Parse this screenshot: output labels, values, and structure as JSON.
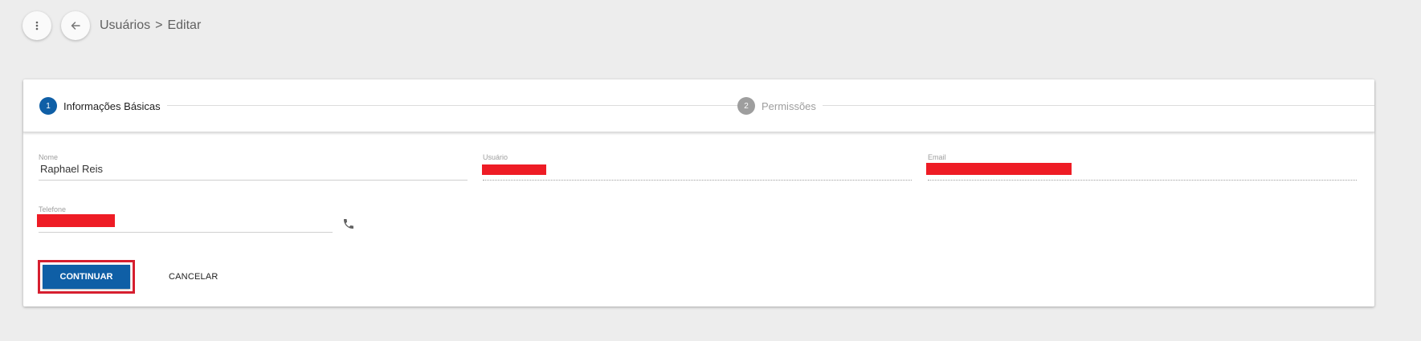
{
  "header": {
    "breadcrumb": {
      "parent": "Usuários",
      "separator": ">",
      "current": "Editar"
    },
    "menu_icon": "vertical-dots-icon",
    "back_icon": "arrow-left-icon"
  },
  "stepper": {
    "steps": [
      {
        "number": "1",
        "label": "Informações Básicas",
        "state": "active"
      },
      {
        "number": "2",
        "label": "Permissões",
        "state": "inactive"
      }
    ]
  },
  "form": {
    "nome": {
      "label": "Nome",
      "value": "Raphael Reis"
    },
    "usuario": {
      "label": "Usuário",
      "value": ""
    },
    "email": {
      "label": "Email",
      "value": ""
    },
    "telefone": {
      "label": "Telefone",
      "value": ""
    },
    "phone_icon": "phone-icon"
  },
  "actions": {
    "continue_label": "CONTINUAR",
    "cancel_label": "CANCELAR"
  },
  "colors": {
    "primary": "#0f5fa6",
    "redaction": "#ee1c25",
    "highlight_border": "#d61f2f",
    "background": "#ededed"
  }
}
